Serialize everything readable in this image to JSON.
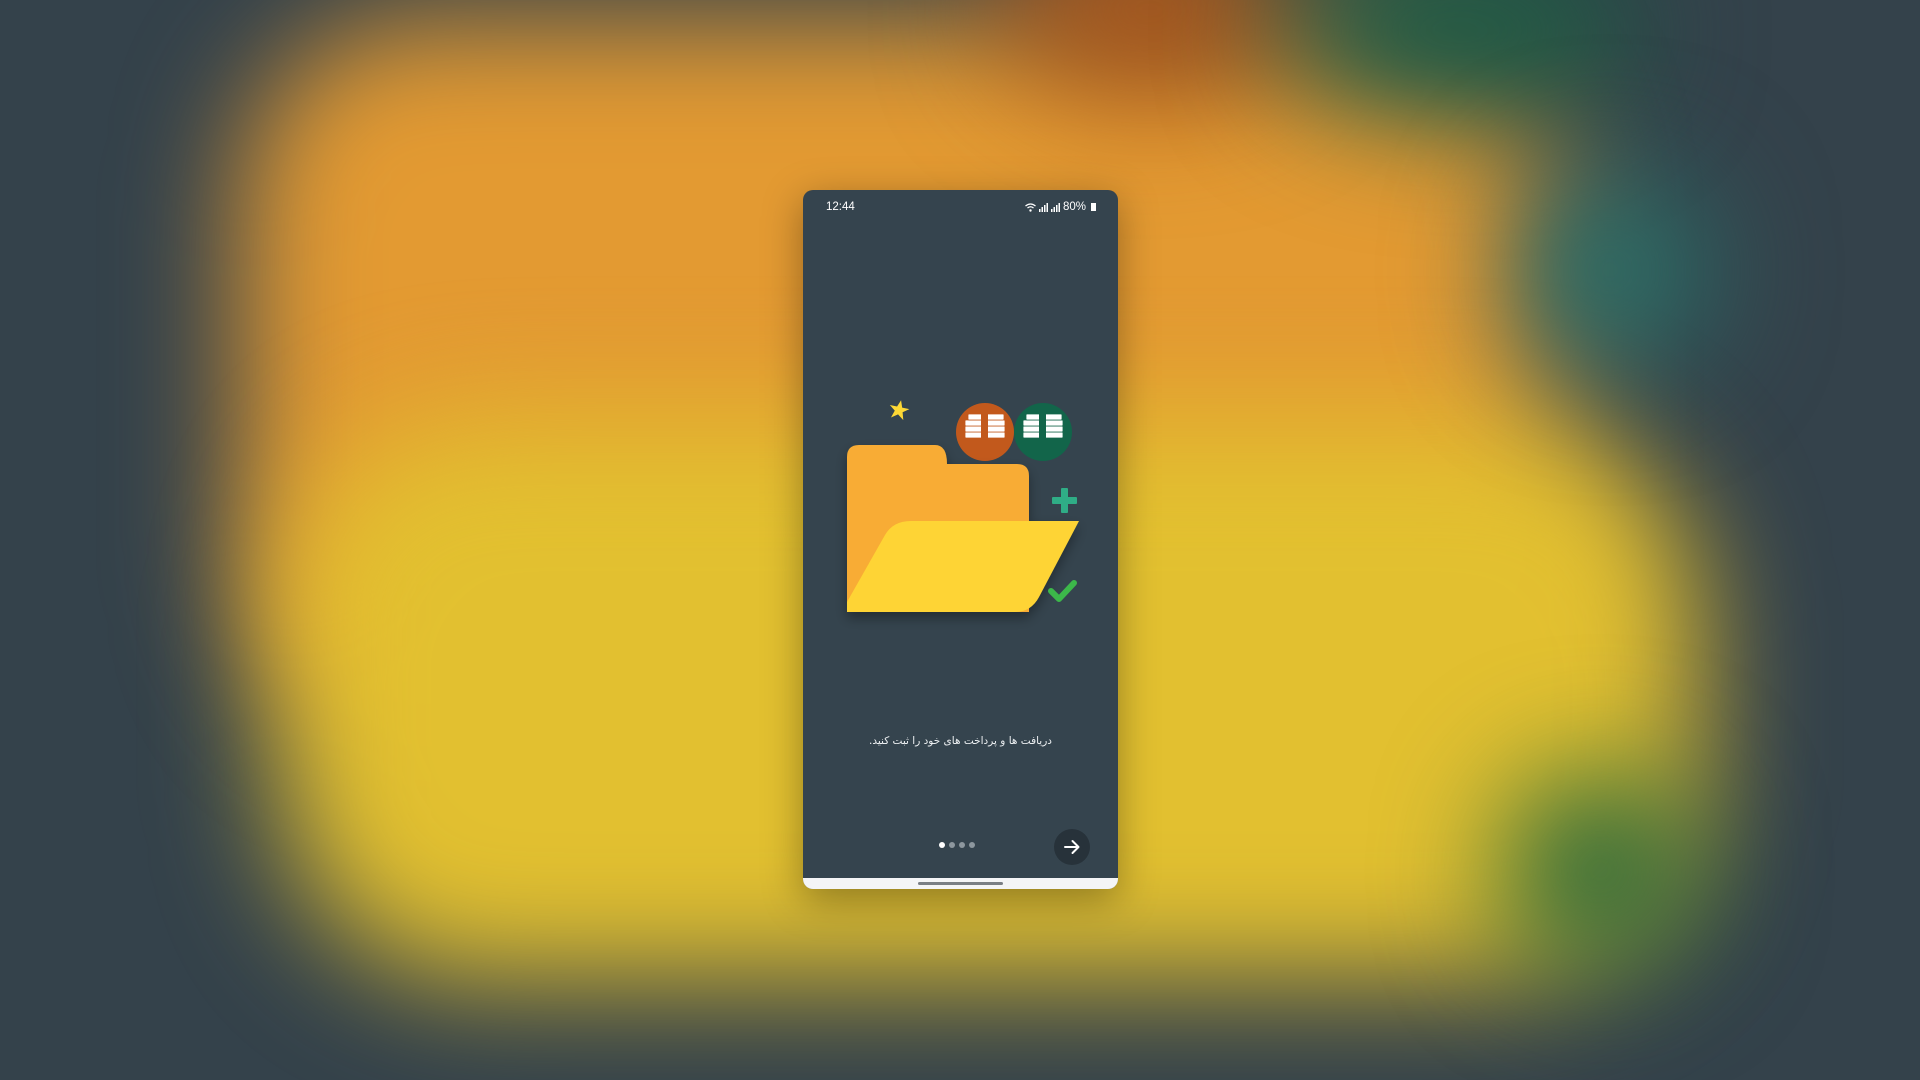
{
  "status_bar": {
    "time": "12:44",
    "battery": "80%",
    "icons": [
      "wifi-icon",
      "signal-icon",
      "signal-icon",
      "battery-icon"
    ]
  },
  "onboarding": {
    "message": "دریافت ها و پرداخت های خود را ثبت کنید.",
    "page_count": 4,
    "active_page": 1,
    "next_icon": "arrow-right-icon"
  },
  "illustration": {
    "icons": [
      "folder-icon",
      "star-icon",
      "money-stack-icon",
      "plus-icon",
      "check-icon"
    ],
    "colors": {
      "folder_back": "#f8ac34",
      "folder_front": "#fed434",
      "star": "#fdd835",
      "coin_orange": "#c2591c",
      "coin_green": "#12654a",
      "plus": "#2fad86",
      "check": "#3cb84a"
    }
  },
  "colors": {
    "screen_bg": "#35444e",
    "button_bg": "#27323a",
    "backdrop_orange": "#e39a32",
    "backdrop_yellow": "#e2c030"
  }
}
